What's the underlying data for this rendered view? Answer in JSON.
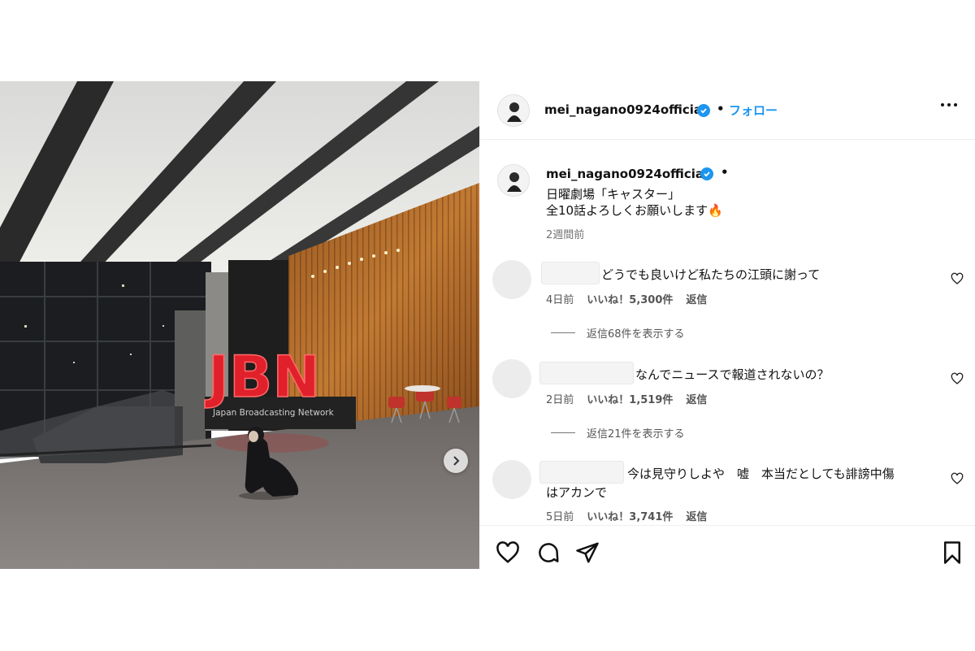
{
  "post": {
    "username": "mei_nagano0924official",
    "follow_label": "フォロー",
    "photo": {
      "sign_text": "JBN",
      "sign_subtext": "Japan Broadcasting Network"
    },
    "caption": {
      "username": "mei_nagano0924official",
      "lines": [
        "日曜劇場「キャスター」",
        "全10話よろしくお願いします🔥"
      ],
      "time": "2週間前"
    }
  },
  "comments": [
    {
      "text": "どうでも良いけど私たちの江頭に謝って",
      "time": "4日前",
      "likes": "いいね！5,300件",
      "reply_label": "返信",
      "view_replies": "返信68件を表示する"
    },
    {
      "text": "なんでニュースで報道されないの？",
      "time": "2日前",
      "likes": "いいね！1,519件",
      "reply_label": "返信",
      "view_replies": "返信21件を表示する"
    },
    {
      "text_line1": "今は見守りしよや　嘘　本当だとしても誹謗中傷",
      "text_line2": "はアカンで",
      "time": "5日前",
      "likes": "いいね！3,741件",
      "reply_label": "返信"
    }
  ],
  "icons": {
    "verified": "verified-badge-icon",
    "more": "more-options-icon",
    "next": "chevron-right-icon",
    "like": "heart-icon",
    "comment": "comment-icon",
    "share": "share-icon",
    "save": "bookmark-icon"
  },
  "colors": {
    "accent": "#1c96f0",
    "sign": "#e0202a"
  }
}
